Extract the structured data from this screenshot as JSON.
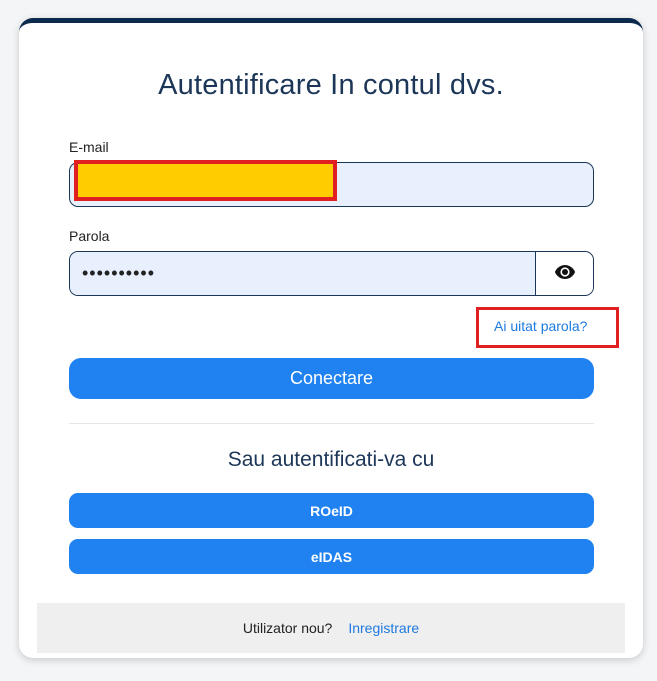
{
  "login": {
    "title": "Autentificare In contul dvs.",
    "email_label": "E-mail",
    "email_value": "",
    "password_label": "Parola",
    "password_value": "••••••••••",
    "forgot_link": "Ai uitat parola?",
    "login_button": "Conectare",
    "alt_title": "Sau autentificati-va cu",
    "providers": [
      {
        "label": "ROeID"
      },
      {
        "label": "eIDAS"
      }
    ],
    "footer_prompt": "Utilizator nou?",
    "register_link": "Inregistrare"
  },
  "colors": {
    "primary": "#1f82f0",
    "navy": "#0c2a4d",
    "input_bg": "#e8f0fe",
    "highlight": "#ffcc00",
    "annotation_red": "#e02020"
  },
  "icons": {
    "password_toggle": "eye-icon"
  }
}
